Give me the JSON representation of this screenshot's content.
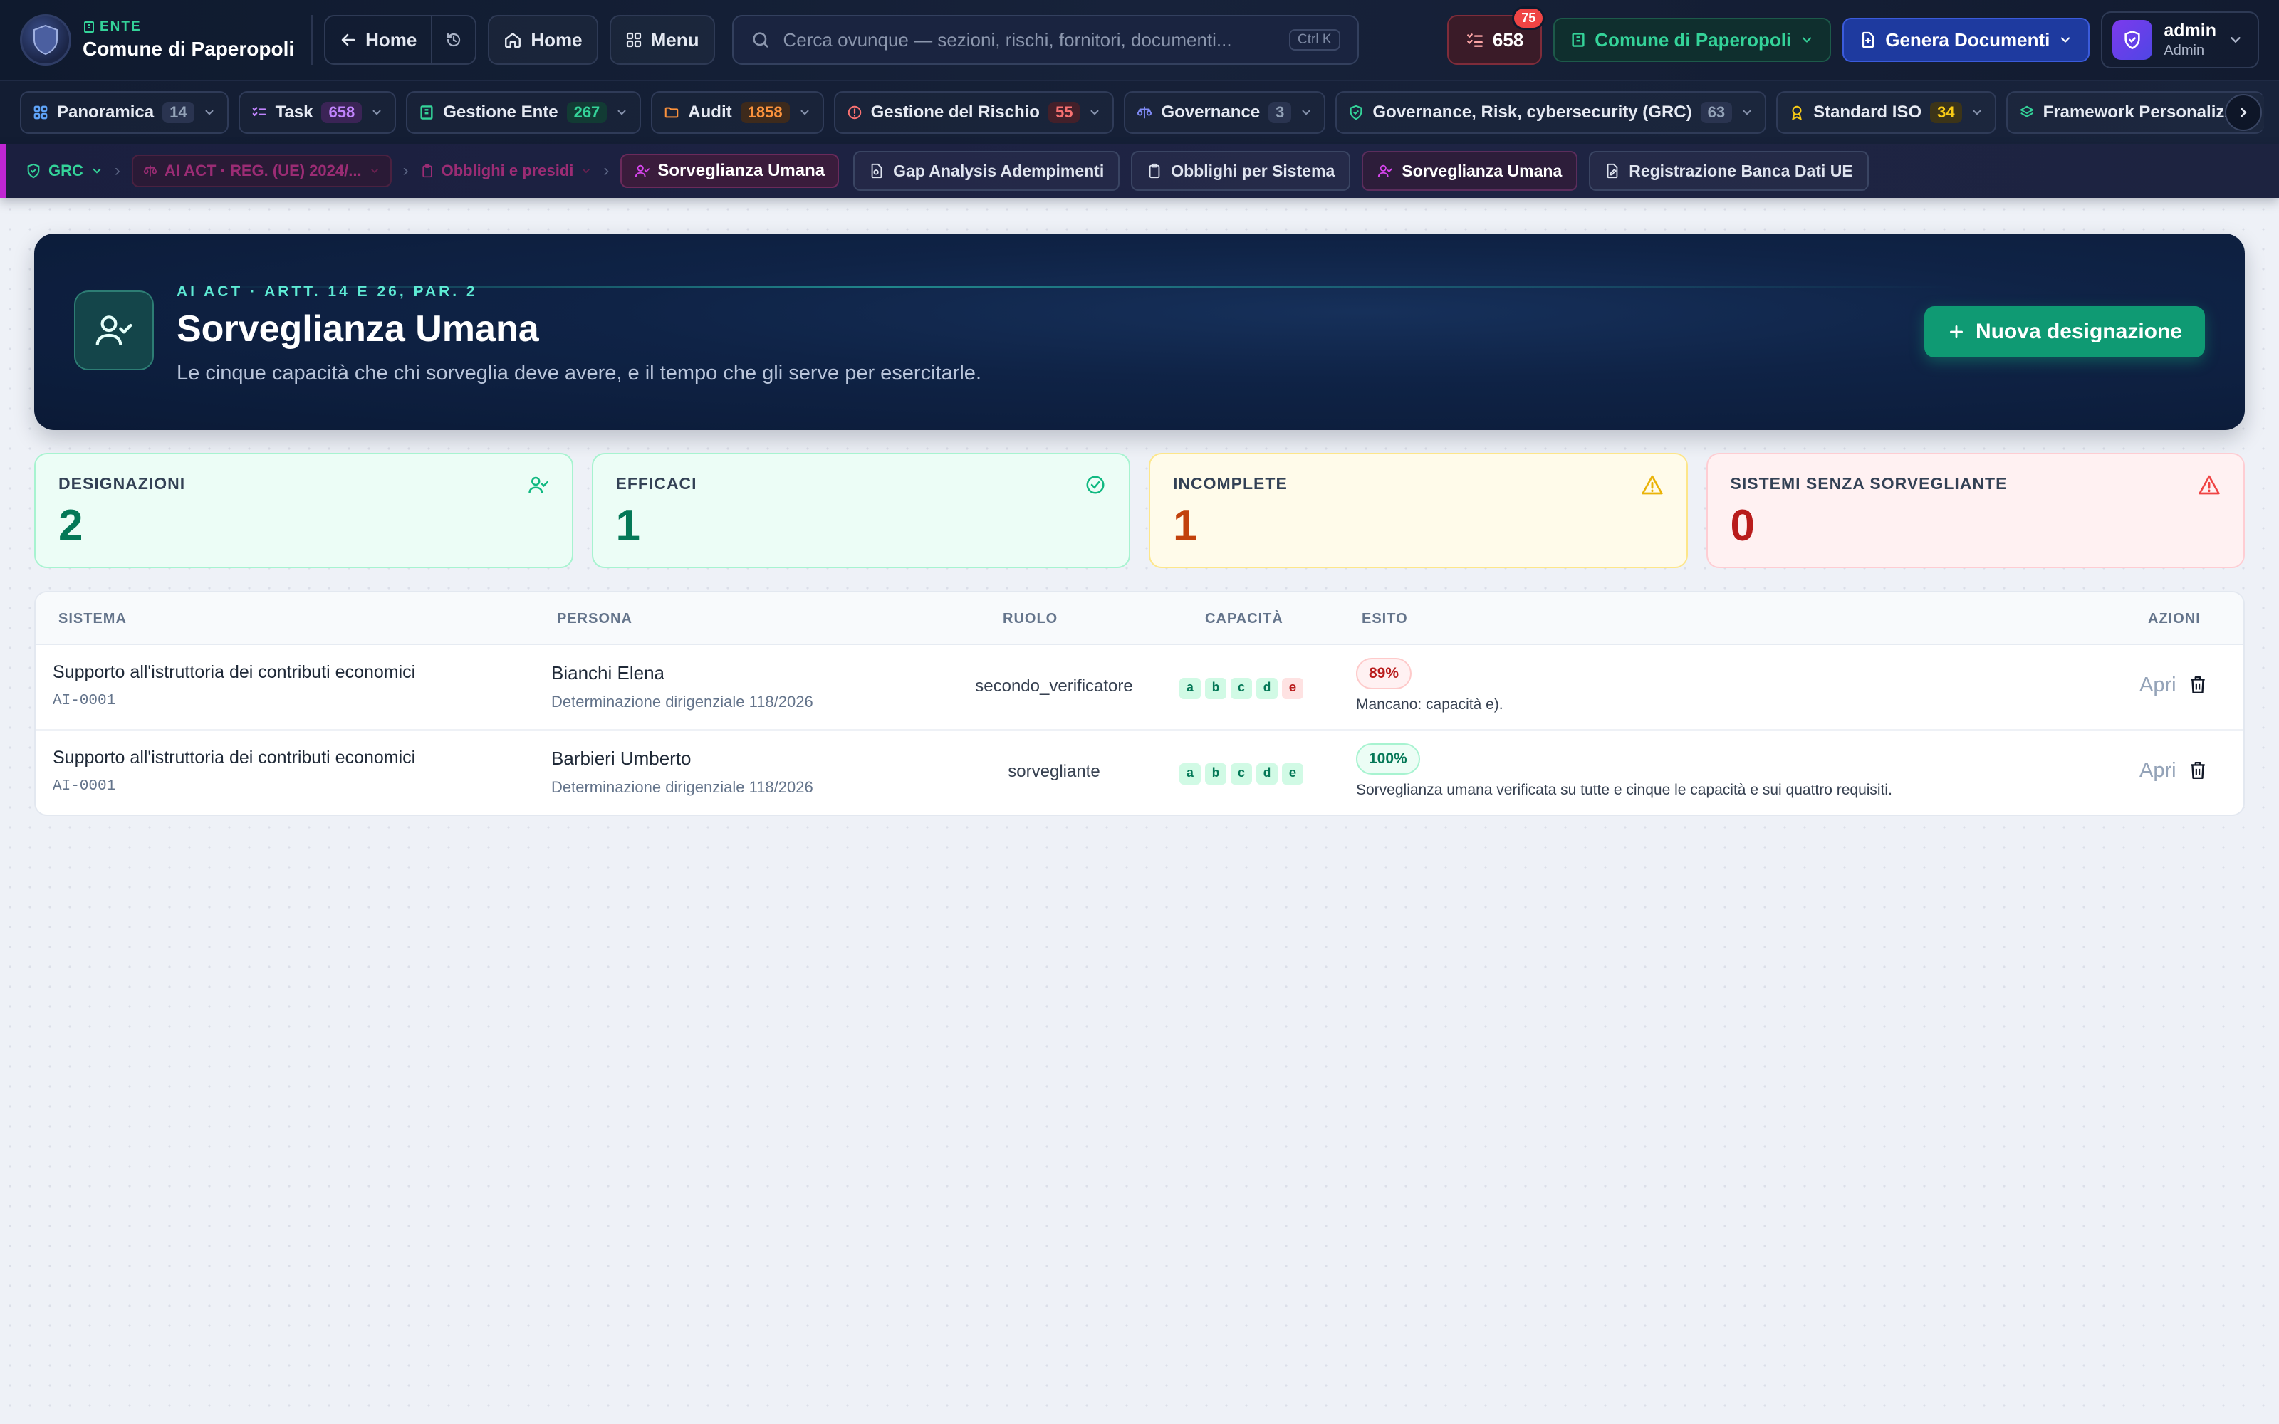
{
  "brand": {
    "kicker": "ENTE",
    "name": "Comune di Paperopoli"
  },
  "topbar": {
    "back_label": "Home",
    "home_label": "Home",
    "menu_label": "Menu",
    "search_placeholder": "Cerca ovunque — sezioni, rischi, fornitori, documenti...",
    "search_shortcut": "Ctrl K",
    "tasks_count": "658",
    "tasks_badge": "75",
    "ente_label": "Comune di Paperopoli",
    "generate_label": "Genera Documenti",
    "user_name": "admin",
    "user_role": "Admin"
  },
  "modules": [
    {
      "label": "Panoramica",
      "count": "14",
      "color": "#94a3b8",
      "bg": "#2a3450"
    },
    {
      "label": "Task",
      "count": "658",
      "color": "#c084fc",
      "bg": "#3b2456"
    },
    {
      "label": "Gestione Ente",
      "count": "267",
      "color": "#34d399",
      "bg": "#123b34"
    },
    {
      "label": "Audit",
      "count": "1858",
      "color": "#fb923c",
      "bg": "#3d2a1c"
    },
    {
      "label": "Gestione del Rischio",
      "count": "55",
      "color": "#f87171",
      "bg": "#43202a"
    },
    {
      "label": "Governance",
      "count": "3",
      "color": "#94a3b8",
      "bg": "#2a3450"
    },
    {
      "label": "Governance, Risk, cybersecurity (GRC)",
      "count": "63",
      "color": "#94a3b8",
      "bg": "#2a3450"
    },
    {
      "label": "Standard ISO",
      "count": "34",
      "color": "#facc15",
      "bg": "#3c3418"
    },
    {
      "label": "Framework Personalizzati",
      "count": "",
      "color": "#94a3b8",
      "bg": "transparent"
    }
  ],
  "breadcrumb": {
    "root": "GRC",
    "level1": "AI ACT · REG. (UE) 2024/...",
    "level2": "Obblighi e presidi",
    "current": "Sorveglianza Umana"
  },
  "subtabs": [
    {
      "label": "Gap Analysis Adempimenti"
    },
    {
      "label": "Obblighi per Sistema"
    },
    {
      "label": "Sorveglianza Umana"
    },
    {
      "label": "Registrazione Banca Dati UE"
    }
  ],
  "hero": {
    "kicker": "AI ACT · ARTT. 14 E 26, PAR. 2",
    "title": "Sorveglianza Umana",
    "subtitle": "Le cinque capacità che chi sorveglia deve avere, e il tempo che gli serve per esercitarle.",
    "button_label": "Nuova designazione"
  },
  "stats": [
    {
      "label": "DESIGNAZIONI",
      "value": "2",
      "icon": "user-check-icon"
    },
    {
      "label": "EFFICACI",
      "value": "1",
      "icon": "check-circle-icon"
    },
    {
      "label": "INCOMPLETE",
      "value": "1",
      "icon": "warning-icon"
    },
    {
      "label": "SISTEMI SENZA SORVEGLIANTE",
      "value": "0",
      "icon": "warning-icon"
    }
  ],
  "table": {
    "headers": {
      "sistema": "SISTEMA",
      "persona": "PERSONA",
      "ruolo": "RUOLO",
      "capacita": "CAPACITÀ",
      "esito": "ESITO",
      "azioni": "AZIONI"
    },
    "rows": [
      {
        "system": "Supporto all'istruttoria dei contributi economici",
        "system_code": "AI-0001",
        "person": "Bianchi Elena",
        "determination": "Determinazione dirigenziale 118/2026",
        "role": "secondo_verificatore",
        "capacities": [
          "a",
          "b",
          "c",
          "d",
          "e"
        ],
        "cap_ok": [
          true,
          true,
          true,
          true,
          false
        ],
        "score": "89%",
        "score_good": false,
        "note": "Mancano: capacità e).",
        "open_label": "Apri"
      },
      {
        "system": "Supporto all'istruttoria dei contributi economici",
        "system_code": "AI-0001",
        "person": "Barbieri Umberto",
        "determination": "Determinazione dirigenziale 118/2026",
        "role": "sorvegliante",
        "capacities": [
          "a",
          "b",
          "c",
          "d",
          "e"
        ],
        "cap_ok": [
          true,
          true,
          true,
          true,
          true
        ],
        "score": "100%",
        "score_good": true,
        "note": "Sorveglianza umana verificata su tutte e cinque le capacità e sui quattro requisiti.",
        "open_label": "Apri"
      }
    ]
  }
}
